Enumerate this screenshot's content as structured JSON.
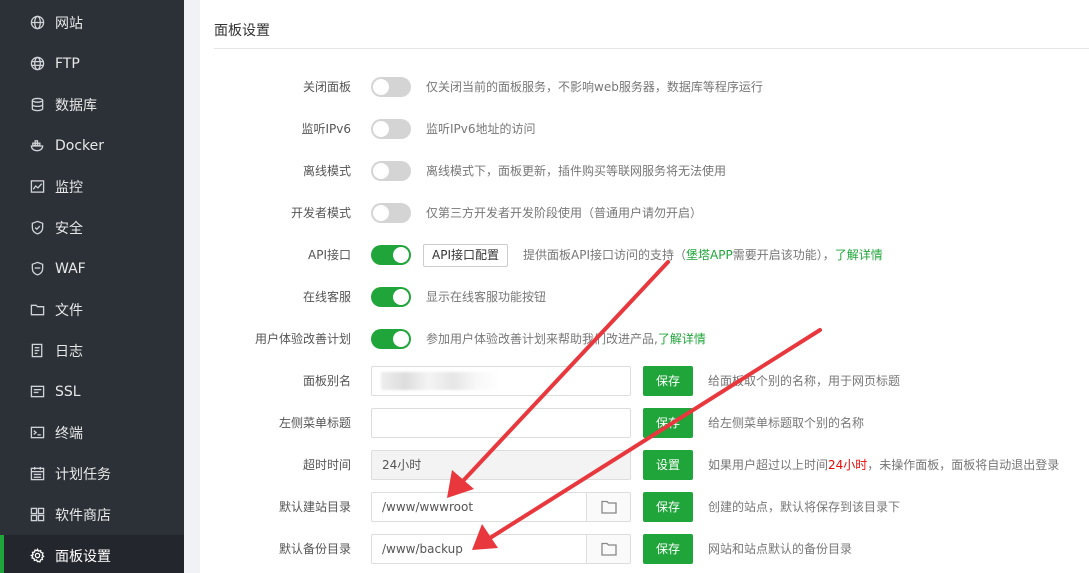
{
  "sidebar": {
    "items": [
      {
        "label": "网站",
        "icon": "globe-icon"
      },
      {
        "label": "FTP",
        "icon": "ftp-globe-icon"
      },
      {
        "label": "数据库",
        "icon": "database-icon"
      },
      {
        "label": "Docker",
        "icon": "docker-icon"
      },
      {
        "label": "监控",
        "icon": "monitor-chart-icon"
      },
      {
        "label": "安全",
        "icon": "shield-icon"
      },
      {
        "label": "WAF",
        "icon": "waf-shield-icon"
      },
      {
        "label": "文件",
        "icon": "folder-icon"
      },
      {
        "label": "日志",
        "icon": "log-document-icon"
      },
      {
        "label": "SSL",
        "icon": "ssl-certificate-icon"
      },
      {
        "label": "终端",
        "icon": "terminal-icon"
      },
      {
        "label": "计划任务",
        "icon": "calendar-task-icon"
      },
      {
        "label": "软件商店",
        "icon": "app-grid-icon"
      },
      {
        "label": "面板设置",
        "icon": "gear-icon"
      }
    ],
    "active_index": 13
  },
  "panel": {
    "title": "面板设置",
    "rows": {
      "close_panel": {
        "label": "关闭面板",
        "enabled": false,
        "desc": "仅关闭当前的面板服务，不影响web服务器，数据库等程序运行"
      },
      "ipv6": {
        "label": "监听IPv6",
        "enabled": false,
        "desc": "监听IPv6地址的访问"
      },
      "offline": {
        "label": "离线模式",
        "enabled": false,
        "desc": "离线模式下，面板更新，插件购买等联网服务将无法使用"
      },
      "developer": {
        "label": "开发者模式",
        "enabled": false,
        "desc": "仅第三方开发者开发阶段使用（普通用户请勿开启）"
      },
      "api": {
        "label": "API接口",
        "enabled": true,
        "button": "API接口配置",
        "desc_pre": "提供面板API接口访问的支持（",
        "desc_green": "堡塔APP",
        "desc_post": "需要开启该功能），",
        "link": "了解详情"
      },
      "online_service": {
        "label": "在线客服",
        "enabled": true,
        "desc": "显示在线客服功能按钮"
      },
      "ux_plan": {
        "label": "用户体验改善计划",
        "enabled": true,
        "desc": "参加用户体验改善计划来帮助我们改进产品,",
        "link": "了解详情"
      },
      "alias": {
        "label": "面板别名",
        "value": "",
        "save": "保存",
        "desc": "给面板取个别的名称，用于网页标题"
      },
      "menu_title": {
        "label": "左侧菜单标题",
        "value": "",
        "save": "保存",
        "desc": "给左侧菜单标题取个别的名称"
      },
      "timeout": {
        "label": "超时时间",
        "value": "24小时",
        "button": "设置",
        "desc_pre": "如果用户超过以上时间",
        "desc_red": "24小时",
        "desc_post": "，未操作面板，面板将自动退出登录"
      },
      "site_dir": {
        "label": "默认建站目录",
        "value": "/www/wwwroot",
        "save": "保存",
        "desc": "创建的站点，默认将保存到该目录下"
      },
      "backup_dir": {
        "label": "默认备份目录",
        "value": "/www/backup",
        "save": "保存",
        "desc": "网站和站点默认的备份目录"
      }
    }
  },
  "colors": {
    "sidebar_bg": "#2c3138",
    "accent_green": "#20a53a",
    "arrow_red": "#e8383d",
    "highlight_red": "#ef0808"
  }
}
